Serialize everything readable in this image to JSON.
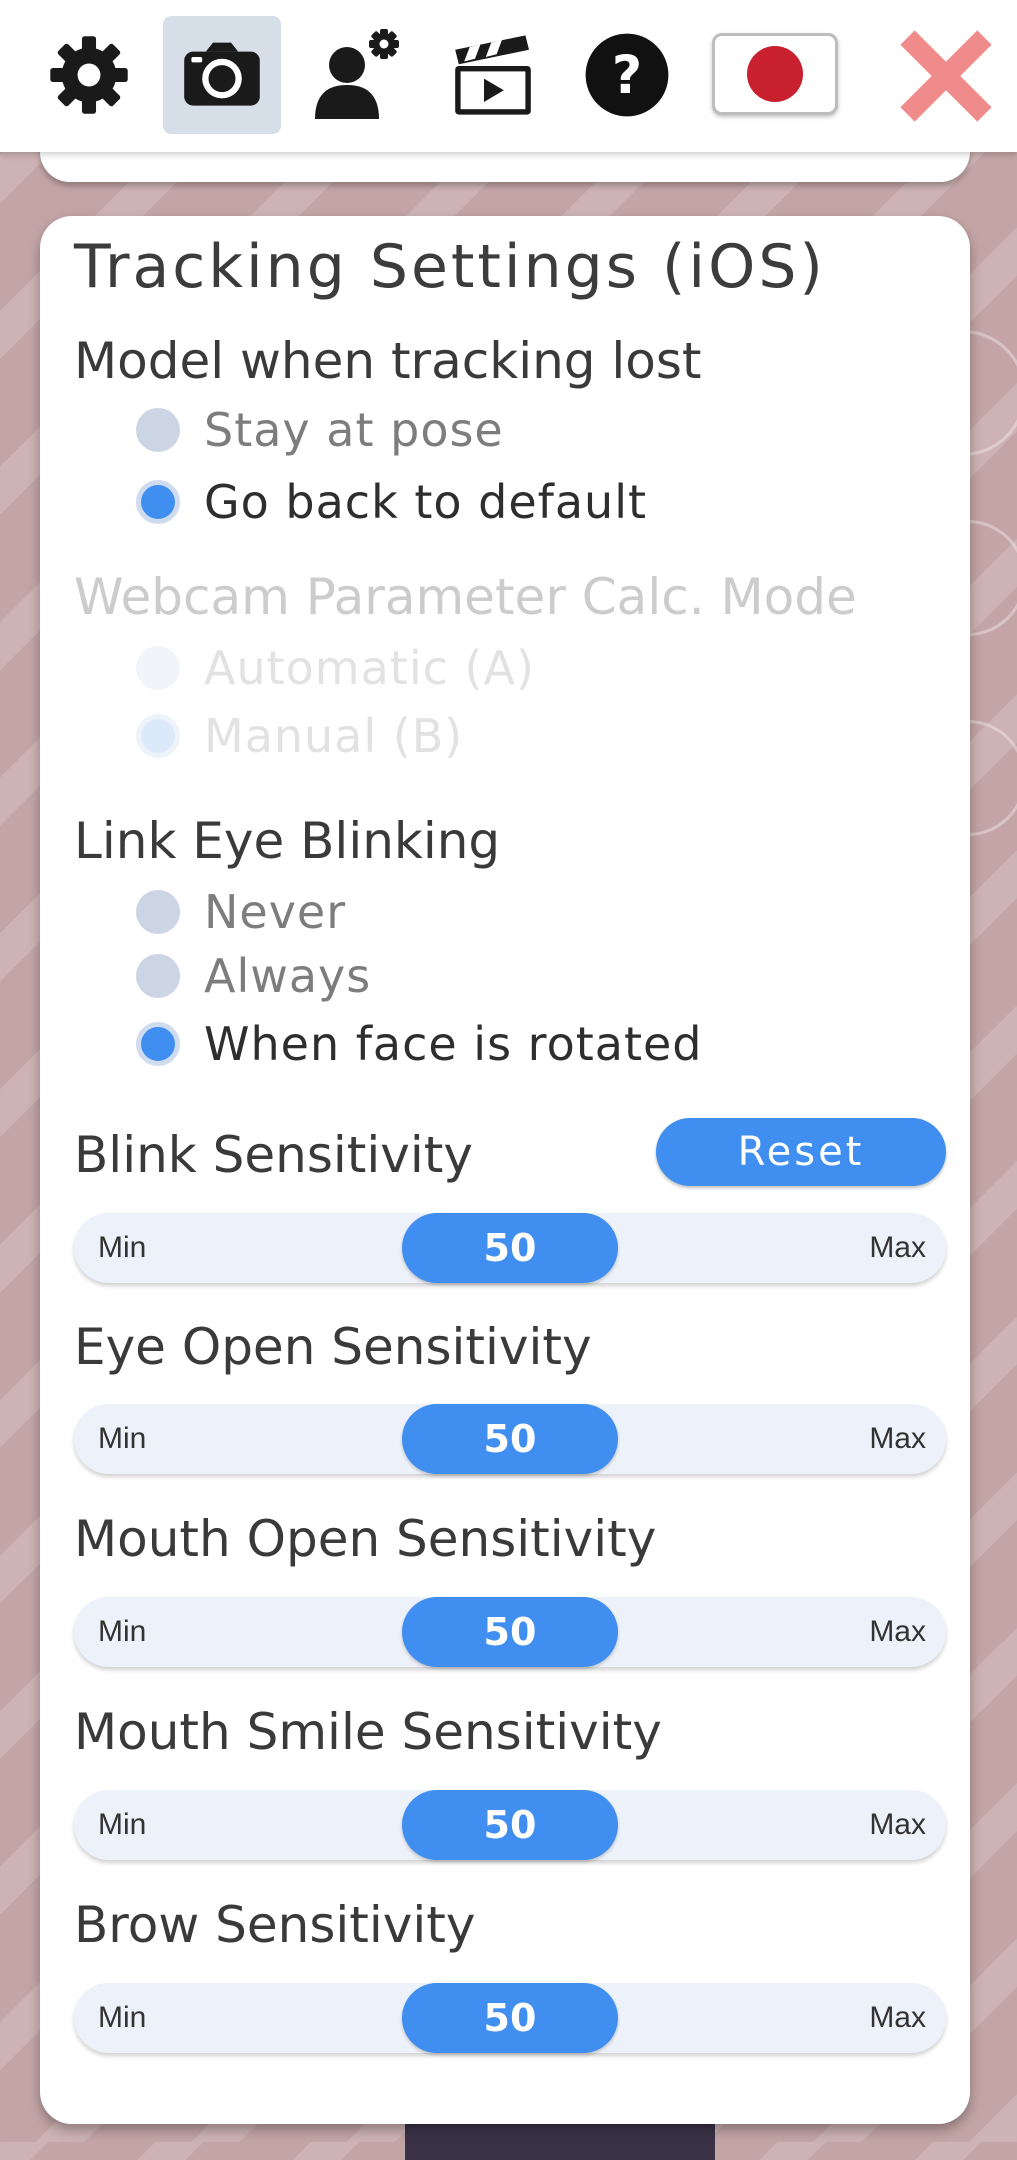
{
  "toolbar": {
    "items": [
      {
        "icon": "gear-icon"
      },
      {
        "icon": "camera-icon",
        "active": true
      },
      {
        "icon": "user-settings-icon"
      },
      {
        "icon": "clapperboard-icon"
      },
      {
        "icon": "help-icon"
      },
      {
        "icon": "japan-flag-icon"
      },
      {
        "icon": "close-icon"
      }
    ],
    "help_glyph": "?"
  },
  "panel": {
    "title": "Tracking Settings (iOS)",
    "tracking_lost": {
      "label": "Model when tracking lost",
      "options": [
        {
          "label": "Stay at pose",
          "selected": false
        },
        {
          "label": "Go back to default",
          "selected": true
        }
      ]
    },
    "webcam_mode": {
      "label": "Webcam Parameter Calc. Mode",
      "disabled": true,
      "options": [
        {
          "label": "Automatic (A)",
          "selected": false
        },
        {
          "label": "Manual (B)",
          "selected": true
        }
      ]
    },
    "link_eye_blinking": {
      "label": "Link Eye Blinking",
      "options": [
        {
          "label": "Never",
          "selected": false
        },
        {
          "label": "Always",
          "selected": false
        },
        {
          "label": "When face is rotated",
          "selected": true
        }
      ]
    },
    "reset_label": "Reset",
    "slider_min_label": "Min",
    "slider_max_label": "Max",
    "sliders": [
      {
        "label": "Blink Sensitivity",
        "value": 50
      },
      {
        "label": "Eye Open Sensitivity",
        "value": 50
      },
      {
        "label": "Mouth Open Sensitivity",
        "value": 50
      },
      {
        "label": "Mouth Smile Sensitivity",
        "value": 50
      },
      {
        "label": "Brow Sensitivity",
        "value": 50
      }
    ]
  },
  "colors": {
    "accent": "#3f8ef0",
    "close": "#ef8b8b",
    "flag_red": "#c8202e",
    "background": "#c3a5a5"
  }
}
